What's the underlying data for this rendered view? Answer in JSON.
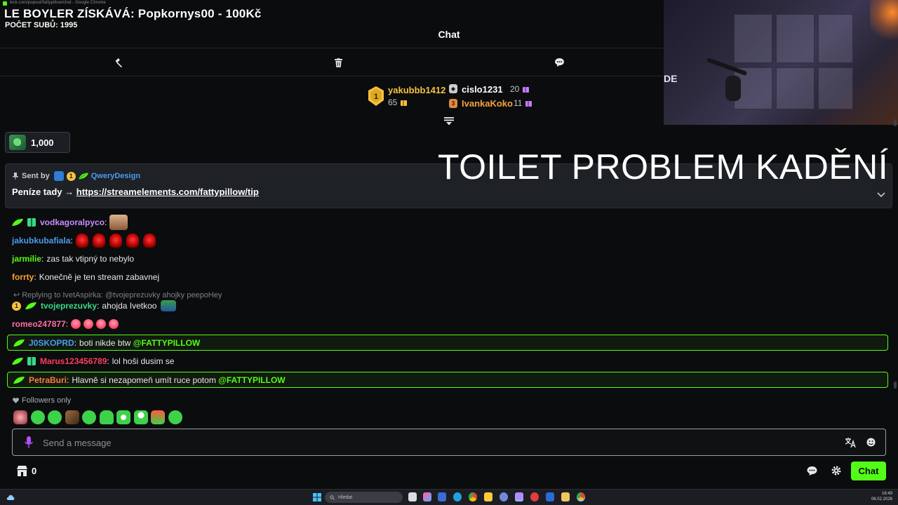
{
  "browser": {
    "url": "kick.com/popout/fattypillow/chat - Google Chrome"
  },
  "banner": {
    "title": "LE BOYLER ZÍSKÁVÁ: Popkornys00 - 100Kč",
    "subs": "POČET SUBŮ: 1995"
  },
  "header": {
    "title": "Chat"
  },
  "webcam": {
    "visible_text": "DE"
  },
  "leaderboard": {
    "first": {
      "rank": "1",
      "name": "yakubbb1412",
      "count": "65",
      "color": "#f5c242"
    },
    "second": {
      "name": "cislo1231",
      "count": "20"
    },
    "third": {
      "name": "IvankaKoko",
      "count": "11"
    }
  },
  "kicks": {
    "amount": "1,000"
  },
  "pinned": {
    "sent_by": "Sent by",
    "badge_number": "1",
    "user": "QweryDesign",
    "text": "Peníze tady → ",
    "link": "https://streamelements.com/fattypillow/tip"
  },
  "overlay": {
    "big_text": "TOILET PROBLEM KADĚNÍ"
  },
  "messages": [
    {
      "user": "vodkagoralpyco",
      "color": "#c78cff",
      "text": ""
    },
    {
      "user": "jakubkubafiala",
      "color": "#4a9cf0",
      "text": ""
    },
    {
      "user": "jarmilie",
      "color": "#53fc18",
      "text": "zas tak vtipný to nebylo"
    },
    {
      "user": "forrty",
      "color": "#ff9f2e",
      "text": "Konečně je ten stream zabavnej"
    },
    {
      "reply": "Replying to IvetAspirka: @tvojeprezuvky ahojky peepoHey"
    },
    {
      "badge_number": "1",
      "user": "tvojeprezuvky",
      "color": "#39d98a",
      "text": "ahojda Ivetkoo"
    },
    {
      "user": "romeo247877",
      "color": "#ff6fa5",
      "text": ""
    },
    {
      "user": "J0SKOPRD",
      "color": "#4a9cf0",
      "text": "boti nikde btw",
      "mention": "@FATTYPILLOW"
    },
    {
      "user": "Marus123456789",
      "color": "#ff3b5c",
      "text": "lol hoši dusim se"
    },
    {
      "user": "PetraBuri",
      "color": "#ff7a45",
      "text": "Hlavně si nezapomeň umít ruce potom",
      "mention": "@FATTYPILLOW"
    }
  ],
  "followers_only": {
    "label": "Followers only"
  },
  "input": {
    "placeholder": "Send a message"
  },
  "footer": {
    "store_count": "0",
    "chat_button": "Chat"
  },
  "taskbar": {
    "search_placeholder": "Hledat",
    "time": "16:49",
    "date": "06.02.2026"
  },
  "colors": {
    "accent": "#53fc18",
    "gold": "#f5c242",
    "background": "#0b0c0d"
  }
}
